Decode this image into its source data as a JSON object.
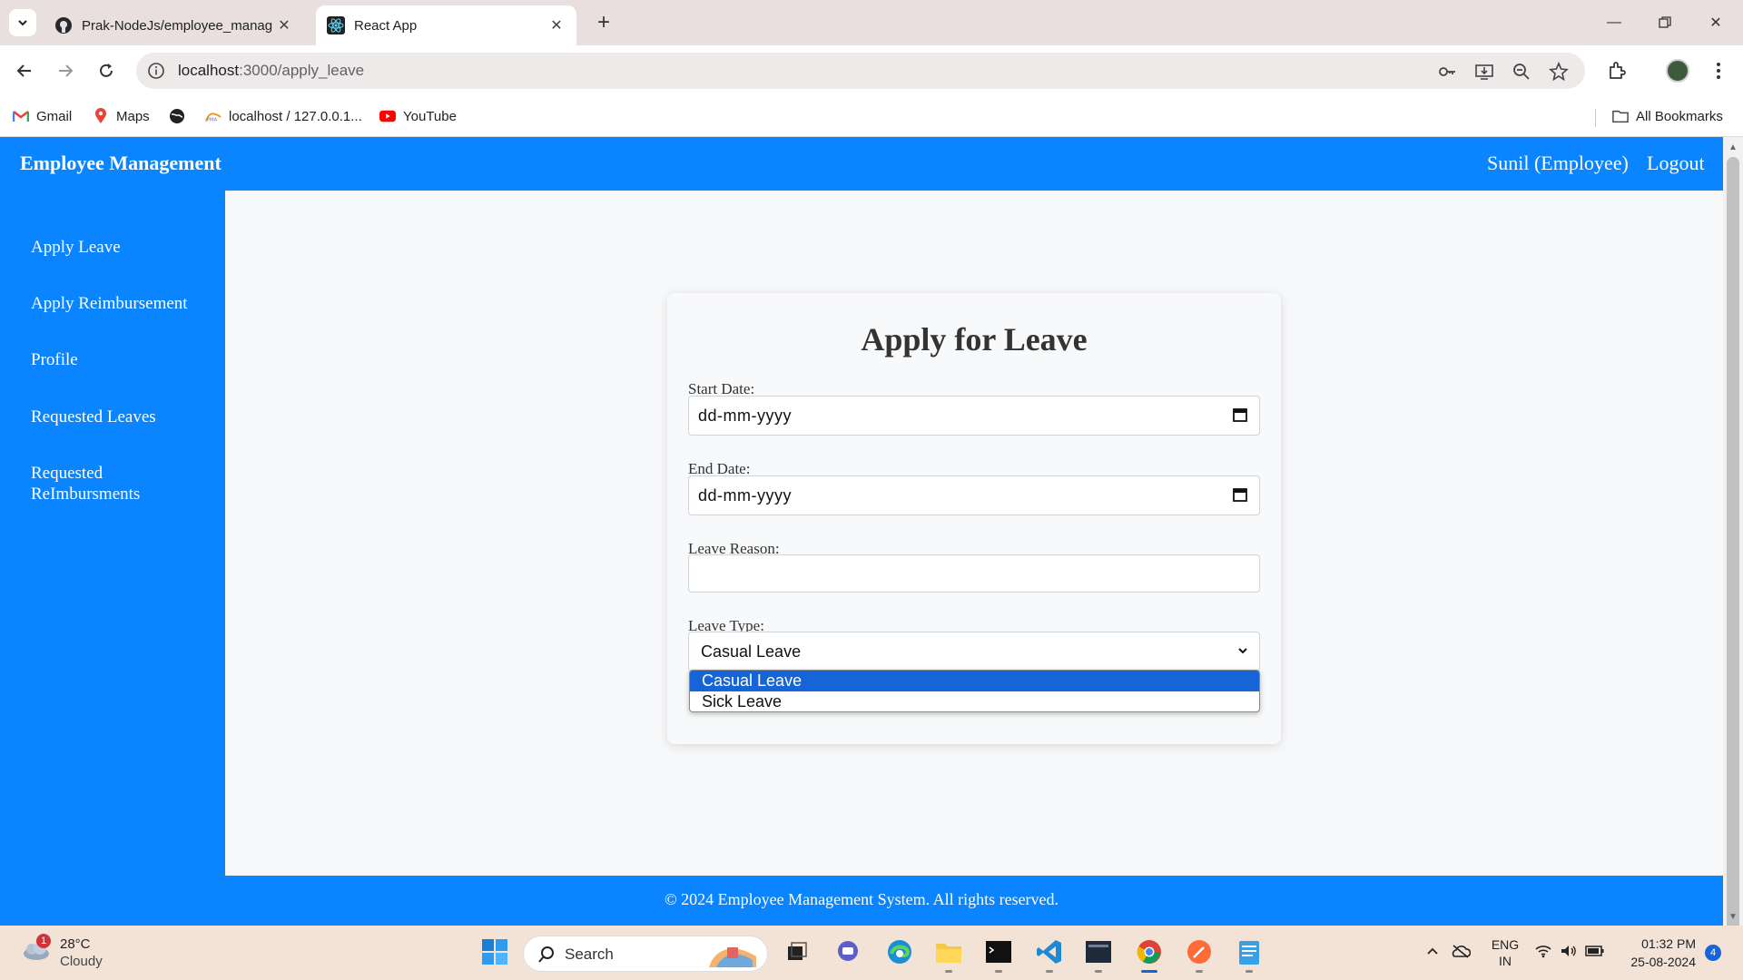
{
  "browser": {
    "tabs": [
      {
        "title": "Prak-NodeJs/employee_manag",
        "active": false
      },
      {
        "title": "React App",
        "active": true
      }
    ],
    "url_host": "localhost",
    "url_path": ":3000/apply_leave",
    "bookmarks": [
      {
        "label": "Gmail",
        "icon": "gmail-icon"
      },
      {
        "label": "Maps",
        "icon": "maps-icon"
      },
      {
        "label": "",
        "icon": "globe-icon"
      },
      {
        "label": "localhost / 127.0.0.1...",
        "icon": "phpmyadmin-icon"
      },
      {
        "label": "YouTube",
        "icon": "youtube-icon"
      }
    ],
    "all_bookmarks": "All Bookmarks"
  },
  "header": {
    "brand": "Employee Management",
    "user": "Sunil (Employee)",
    "logout": "Logout"
  },
  "sidebar": {
    "items": [
      {
        "label": "Apply Leave"
      },
      {
        "label": "Apply Reimbursement"
      },
      {
        "label": "Profile"
      },
      {
        "label": "Requested Leaves"
      },
      {
        "label": "Requested ReImbursments"
      }
    ]
  },
  "form": {
    "title": "Apply for Leave",
    "start_label": "Start Date:",
    "start_value": "dd-mm-yyyy",
    "end_label": "End Date:",
    "end_value": "dd-mm-yyyy",
    "reason_label": "Leave Reason:",
    "reason_value": "",
    "type_label": "Leave Type:",
    "type_value": "Casual Leave",
    "type_options": [
      "Casual Leave",
      "Sick Leave"
    ]
  },
  "footer": {
    "text": "© 2024 Employee Management System. All rights reserved."
  },
  "taskbar": {
    "weather_temp": "28°C",
    "weather_cond": "Cloudy",
    "weather_badge": "1",
    "search": "Search",
    "lang1": "ENG",
    "lang2": "IN",
    "time": "01:32 PM",
    "date": "25-08-2024",
    "notif_count": "4"
  },
  "colors": {
    "brand_blue": "#0a84ff",
    "danger_red": "#c82333",
    "option_highlight": "#1565d8"
  }
}
